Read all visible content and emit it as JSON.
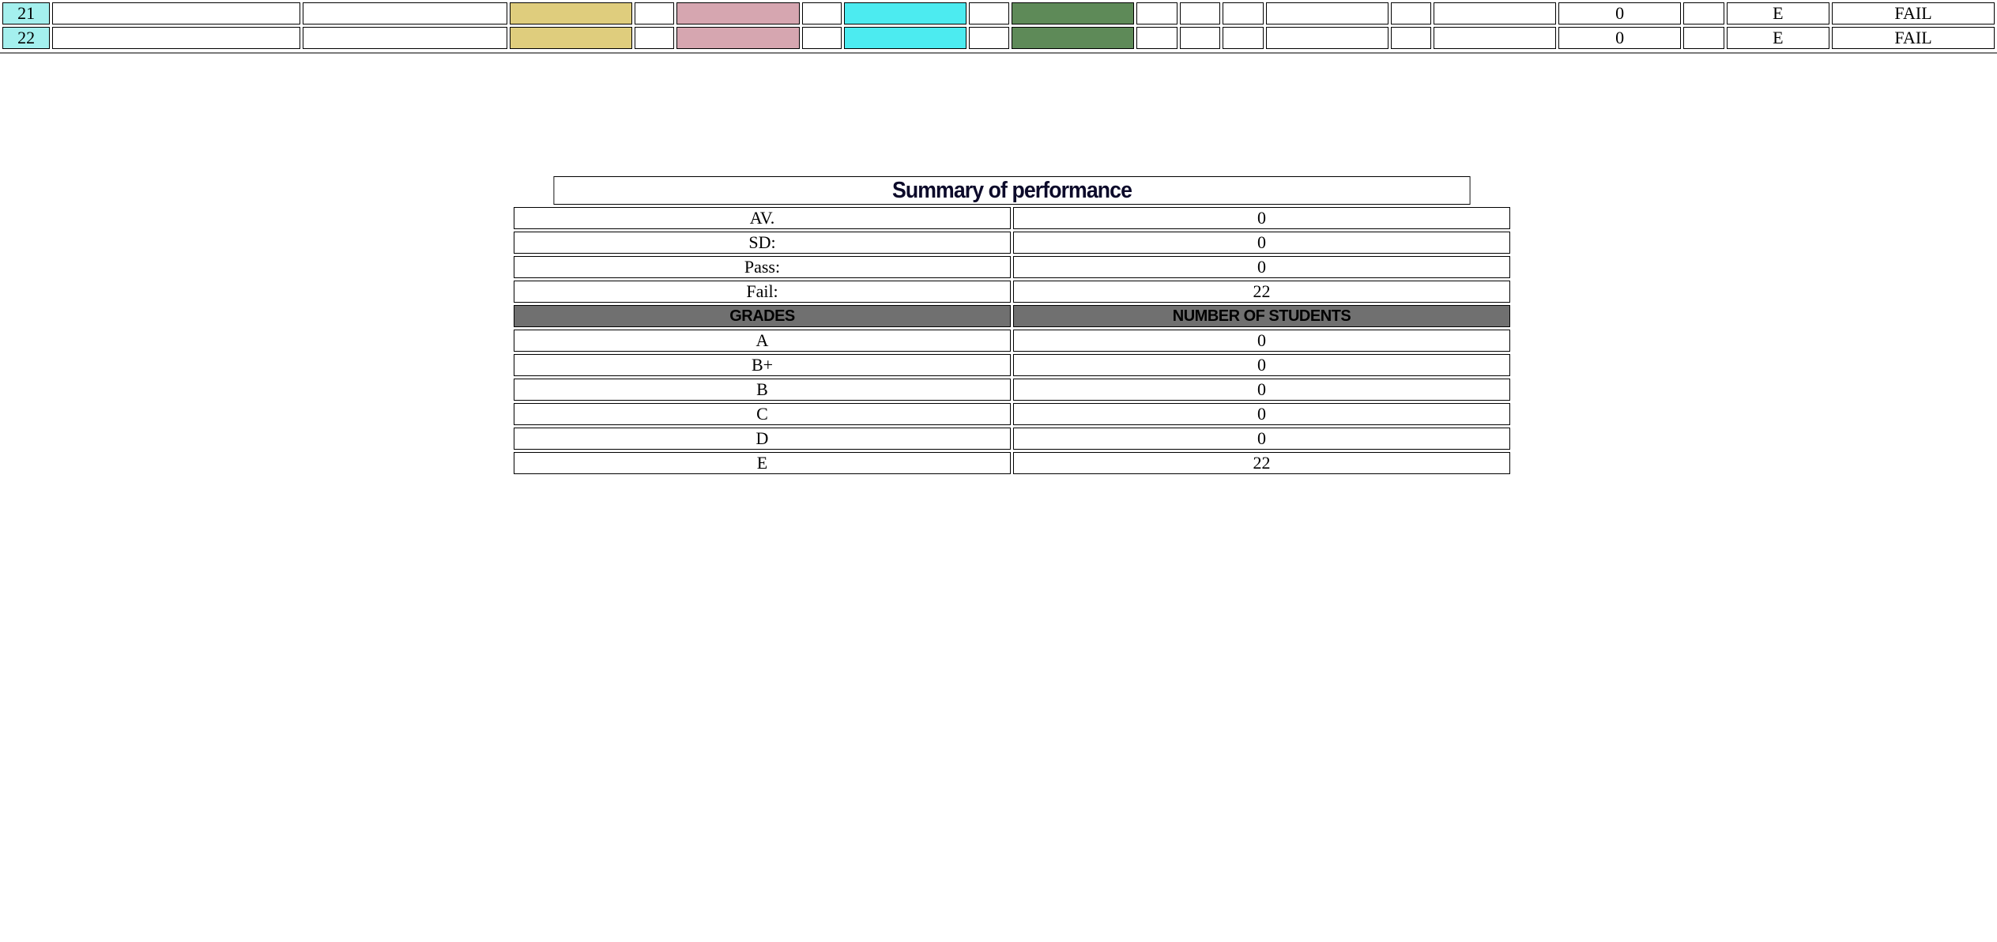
{
  "colors": {
    "index_cell": "#a4f0ee",
    "col_khaki": "#dfcd7d",
    "col_pink": "#d6a6b0",
    "col_cyan": "#4cebf0",
    "col_green": "#5e8a58",
    "header_gray": "#707070"
  },
  "results": {
    "columns": [
      {
        "width": 60,
        "fill": "index"
      },
      {
        "width": 313,
        "fill": ""
      },
      {
        "width": 258,
        "fill": ""
      },
      {
        "width": 154,
        "fill": "khaki"
      },
      {
        "width": 50,
        "fill": ""
      },
      {
        "width": 155,
        "fill": "pink"
      },
      {
        "width": 50,
        "fill": ""
      },
      {
        "width": 155,
        "fill": "cyan"
      },
      {
        "width": 50,
        "fill": ""
      },
      {
        "width": 155,
        "fill": "green"
      },
      {
        "width": 52,
        "fill": ""
      },
      {
        "width": 51,
        "fill": ""
      },
      {
        "width": 51,
        "fill": ""
      },
      {
        "width": 155,
        "fill": ""
      },
      {
        "width": 51,
        "fill": ""
      },
      {
        "width": 154,
        "fill": ""
      },
      {
        "width": 155,
        "fill": ""
      },
      {
        "width": 51,
        "fill": ""
      },
      {
        "width": 130,
        "fill": ""
      },
      {
        "width": 205,
        "fill": ""
      }
    ],
    "rows": [
      {
        "cells": [
          "21",
          "",
          "",
          "",
          "",
          "",
          "",
          "",
          "",
          "",
          "",
          "",
          "",
          "",
          "",
          "",
          "0",
          "",
          "E",
          "FAIL"
        ]
      },
      {
        "cells": [
          "22",
          "",
          "",
          "",
          "",
          "",
          "",
          "",
          "",
          "",
          "",
          "",
          "",
          "",
          "",
          "",
          "0",
          "",
          "E",
          "FAIL"
        ]
      }
    ]
  },
  "summary": {
    "title": "Summary of performance",
    "stats": [
      {
        "label": "AV.",
        "value": "0"
      },
      {
        "label": "SD:",
        "value": "0"
      },
      {
        "label": "Pass:",
        "value": "0"
      },
      {
        "label": "Fail:",
        "value": "22"
      }
    ],
    "grades_header": "GRADES",
    "students_header": "NUMBER OF STUDENTS",
    "grades": [
      {
        "grade": "A",
        "count": "0"
      },
      {
        "grade": "B+",
        "count": "0"
      },
      {
        "grade": "B",
        "count": "0"
      },
      {
        "grade": "C",
        "count": "0"
      },
      {
        "grade": "D",
        "count": "0"
      },
      {
        "grade": "E",
        "count": "22"
      }
    ]
  }
}
